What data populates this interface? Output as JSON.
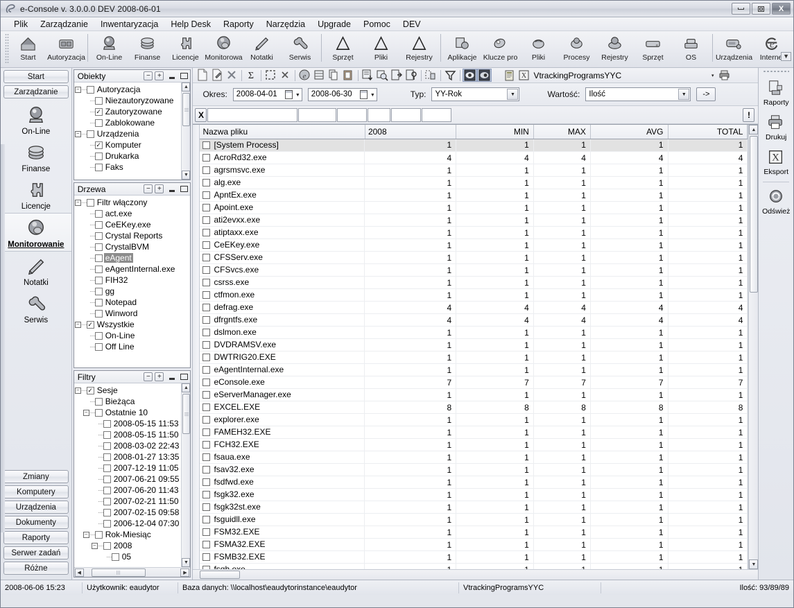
{
  "window": {
    "title": "e-Console v. 3.0.0.0 DEV 2008-06-01",
    "minimize_label": "Minimalizuj",
    "maximize_label": "Maksymalizuj",
    "close_label": "X"
  },
  "menubar": {
    "items": [
      "Plik",
      "Zarządzanie",
      "Inwentaryzacja",
      "Help Desk",
      "Raporty",
      "Narzędzia",
      "Upgrade",
      "Pomoc",
      "DEV"
    ]
  },
  "toolbar": {
    "groups": [
      [
        {
          "label": "Start",
          "icon": "home-icon"
        },
        {
          "label": "Autoryzacja",
          "icon": "authorize-icon"
        }
      ],
      [
        {
          "label": "On-Line",
          "icon": "online-icon"
        },
        {
          "label": "Finanse",
          "icon": "finance-icon"
        },
        {
          "label": "Licencje",
          "icon": "license-icon"
        },
        {
          "label": "Monitorowa",
          "icon": "monitoring-icon"
        },
        {
          "label": "Notatki",
          "icon": "notes-icon"
        },
        {
          "label": "Serwis",
          "icon": "service-icon"
        }
      ],
      [
        {
          "label": "Sprzęt",
          "icon": "delta-icon"
        },
        {
          "label": "Pliki",
          "icon": "delta-icon"
        },
        {
          "label": "Rejestry",
          "icon": "delta-icon"
        }
      ],
      [
        {
          "label": "Aplikacje",
          "icon": "applications-icon"
        },
        {
          "label": "Klucze pro",
          "icon": "keys-icon"
        },
        {
          "label": "Pliki",
          "icon": "files-icon"
        },
        {
          "label": "Procesy",
          "icon": "processes-icon"
        },
        {
          "label": "Rejestry",
          "icon": "registry-icon"
        },
        {
          "label": "Sprzęt",
          "icon": "hardware-icon"
        },
        {
          "label": "OS",
          "icon": "os-icon"
        }
      ],
      [
        {
          "label": "Urządzenia",
          "icon": "devices-icon"
        },
        {
          "label": "Internet",
          "icon": "internet-icon"
        }
      ]
    ],
    "overflow_label": "▼"
  },
  "leftnav": {
    "top_buttons": [
      "Start",
      "Zarządzanie"
    ],
    "icons": [
      {
        "label": "On-Line",
        "icon": "online-icon",
        "active": false
      },
      {
        "label": "Finanse",
        "icon": "finance-icon",
        "active": false
      },
      {
        "label": "Licencje",
        "icon": "license-icon",
        "active": false
      },
      {
        "label": "Monitorowanie",
        "icon": "monitoring-icon",
        "active": true
      },
      {
        "label": "Notatki",
        "icon": "notes-icon",
        "active": false
      },
      {
        "label": "Serwis",
        "icon": "service-icon",
        "active": false
      }
    ],
    "bottom_buttons": [
      "Zmiany",
      "Komputery",
      "Urządzenia",
      "Dokumenty",
      "Raporty",
      "Serwer zadań",
      "Różne"
    ]
  },
  "panels": [
    {
      "title": "Obiekty",
      "collapse_label": "−",
      "expand_label": "+",
      "nodes": [
        {
          "label": "Autoryzacja",
          "level": 0,
          "checked": false,
          "expander": "−"
        },
        {
          "label": "Niezautoryzowane",
          "level": 1,
          "checked": false
        },
        {
          "label": "Zautoryzowane",
          "level": 1,
          "checked": true
        },
        {
          "label": "Zablokowane",
          "level": 1,
          "checked": false
        },
        {
          "label": "Urządzenia",
          "level": 0,
          "checked": false,
          "expander": "−"
        },
        {
          "label": "Komputer",
          "level": 1,
          "checked": true
        },
        {
          "label": "Drukarka",
          "level": 1,
          "checked": false
        },
        {
          "label": "Faks",
          "level": 1,
          "checked": false
        }
      ]
    },
    {
      "title": "Drzewa",
      "collapse_label": "−",
      "expand_label": "+",
      "nodes": [
        {
          "label": "Filtr włączony",
          "level": 0,
          "checked": false,
          "expander": "−"
        },
        {
          "label": "act.exe",
          "level": 1,
          "checked": false
        },
        {
          "label": "CeEKey.exe",
          "level": 1,
          "checked": false
        },
        {
          "label": "Crystal Reports",
          "level": 1,
          "checked": false
        },
        {
          "label": "CrystalBVM",
          "level": 1,
          "checked": false
        },
        {
          "label": "eAgent",
          "level": 1,
          "checked": false,
          "selected": true
        },
        {
          "label": "eAgentInternal.exe",
          "level": 1,
          "checked": false
        },
        {
          "label": "FIH32",
          "level": 1,
          "checked": false
        },
        {
          "label": "gg",
          "level": 1,
          "checked": false
        },
        {
          "label": "Notepad",
          "level": 1,
          "checked": false
        },
        {
          "label": "Winword",
          "level": 1,
          "checked": false
        },
        {
          "label": "Wszystkie",
          "level": 0,
          "checked": true,
          "expander": "−"
        },
        {
          "label": "On-Line",
          "level": 1,
          "checked": false
        },
        {
          "label": "Off Line",
          "level": 1,
          "checked": false
        }
      ]
    },
    {
      "title": "Filtry",
      "collapse_label": "−",
      "expand_label": "+",
      "nodes": [
        {
          "label": "Sesje",
          "level": 0,
          "checked": true,
          "expander": "−"
        },
        {
          "label": "Bieżąca",
          "level": 1,
          "checked": false
        },
        {
          "label": "Ostatnie 10",
          "level": 1,
          "checked": false,
          "expander": "−"
        },
        {
          "label": "2008-05-15 11:53",
          "level": 2,
          "checked": false
        },
        {
          "label": "2008-05-15 11:50",
          "level": 2,
          "checked": false
        },
        {
          "label": "2008-03-02 22:43",
          "level": 2,
          "checked": false
        },
        {
          "label": "2008-01-27 13:35",
          "level": 2,
          "checked": false
        },
        {
          "label": "2007-12-19 11:05",
          "level": 2,
          "checked": false
        },
        {
          "label": "2007-06-21 09:55",
          "level": 2,
          "checked": false
        },
        {
          "label": "2007-06-20 11:43",
          "level": 2,
          "checked": false
        },
        {
          "label": "2007-02-21 11:50",
          "level": 2,
          "checked": false
        },
        {
          "label": "2007-02-15 09:58",
          "level": 2,
          "checked": false
        },
        {
          "label": "2006-12-04 07:30",
          "level": 2,
          "checked": false
        },
        {
          "label": "Rok-Miesiąc",
          "level": 1,
          "checked": false,
          "expander": "−"
        },
        {
          "label": "2008",
          "level": 2,
          "checked": false,
          "expander": "−"
        },
        {
          "label": "05",
          "level": 3,
          "checked": false
        }
      ]
    }
  ],
  "mini_toolbar": {
    "icons": [
      "new-document-icon",
      "edit-document-icon",
      "delete-x-icon",
      "sum-sigma-icon",
      "select-region-icon",
      "clear-x-icon",
      "browser-icon",
      "list-icon",
      "copy-icon",
      "paste-icon",
      "export-list-icon",
      "search-list-icon",
      "open-out-icon",
      "config-out-icon",
      "columns-icon",
      "filter-funnel-icon",
      "preview-icon",
      "preview2-icon"
    ],
    "report_icon_1": "report-icon",
    "report_icon_2": "excel-icon",
    "report_name": "VtrackingProgramsYYC",
    "dropdown_caret": "▾",
    "print_icon": "print-icon"
  },
  "filterbar": {
    "period_label": "Okres:",
    "date_from": "2008-04-01",
    "date_to": "2008-06-30",
    "type_label": "Typ:",
    "type_value": "YY-Rok",
    "value_label": "Wartość:",
    "value_value": "Ilość",
    "go_label": "->"
  },
  "searchrow": {
    "clear_label": "X",
    "bang_label": "!",
    "fields": [
      "",
      "",
      "",
      "",
      "",
      ""
    ]
  },
  "grid": {
    "columns": [
      "Nazwa pliku",
      "2008",
      "MIN",
      "MAX",
      "AVG",
      "TOTAL"
    ],
    "rows": [
      {
        "name": "[System Process]",
        "v": [
          1,
          1,
          1,
          1,
          1
        ],
        "selected": true
      },
      {
        "name": "AcroRd32.exe",
        "v": [
          4,
          4,
          4,
          4,
          4
        ]
      },
      {
        "name": "agrsmsvc.exe",
        "v": [
          1,
          1,
          1,
          1,
          1
        ]
      },
      {
        "name": "alg.exe",
        "v": [
          1,
          1,
          1,
          1,
          1
        ]
      },
      {
        "name": "ApntEx.exe",
        "v": [
          1,
          1,
          1,
          1,
          1
        ]
      },
      {
        "name": "Apoint.exe",
        "v": [
          1,
          1,
          1,
          1,
          1
        ]
      },
      {
        "name": "ati2evxx.exe",
        "v": [
          1,
          1,
          1,
          1,
          1
        ]
      },
      {
        "name": "atiptaxx.exe",
        "v": [
          1,
          1,
          1,
          1,
          1
        ]
      },
      {
        "name": "CeEKey.exe",
        "v": [
          1,
          1,
          1,
          1,
          1
        ]
      },
      {
        "name": "CFSServ.exe",
        "v": [
          1,
          1,
          1,
          1,
          1
        ]
      },
      {
        "name": "CFSvcs.exe",
        "v": [
          1,
          1,
          1,
          1,
          1
        ]
      },
      {
        "name": "csrss.exe",
        "v": [
          1,
          1,
          1,
          1,
          1
        ]
      },
      {
        "name": "ctfmon.exe",
        "v": [
          1,
          1,
          1,
          1,
          1
        ]
      },
      {
        "name": "defrag.exe",
        "v": [
          4,
          4,
          4,
          4,
          4
        ]
      },
      {
        "name": "dfrgntfs.exe",
        "v": [
          4,
          4,
          4,
          4,
          4
        ]
      },
      {
        "name": "dslmon.exe",
        "v": [
          1,
          1,
          1,
          1,
          1
        ]
      },
      {
        "name": "DVDRAMSV.exe",
        "v": [
          1,
          1,
          1,
          1,
          1
        ]
      },
      {
        "name": "DWTRIG20.EXE",
        "v": [
          1,
          1,
          1,
          1,
          1
        ]
      },
      {
        "name": "eAgentInternal.exe",
        "v": [
          1,
          1,
          1,
          1,
          1
        ]
      },
      {
        "name": "eConsole.exe",
        "v": [
          7,
          7,
          7,
          7,
          7
        ]
      },
      {
        "name": "eServerManager.exe",
        "v": [
          1,
          1,
          1,
          1,
          1
        ]
      },
      {
        "name": "EXCEL.EXE",
        "v": [
          8,
          8,
          8,
          8,
          8
        ]
      },
      {
        "name": "explorer.exe",
        "v": [
          1,
          1,
          1,
          1,
          1
        ]
      },
      {
        "name": "FAMEH32.EXE",
        "v": [
          1,
          1,
          1,
          1,
          1
        ]
      },
      {
        "name": "FCH32.EXE",
        "v": [
          1,
          1,
          1,
          1,
          1
        ]
      },
      {
        "name": "fsaua.exe",
        "v": [
          1,
          1,
          1,
          1,
          1
        ]
      },
      {
        "name": "fsav32.exe",
        "v": [
          1,
          1,
          1,
          1,
          1
        ]
      },
      {
        "name": "fsdfwd.exe",
        "v": [
          1,
          1,
          1,
          1,
          1
        ]
      },
      {
        "name": "fsgk32.exe",
        "v": [
          1,
          1,
          1,
          1,
          1
        ]
      },
      {
        "name": "fsgk32st.exe",
        "v": [
          1,
          1,
          1,
          1,
          1
        ]
      },
      {
        "name": "fsguidll.exe",
        "v": [
          1,
          1,
          1,
          1,
          1
        ]
      },
      {
        "name": "FSM32.EXE",
        "v": [
          1,
          1,
          1,
          1,
          1
        ]
      },
      {
        "name": "FSMA32.EXE",
        "v": [
          1,
          1,
          1,
          1,
          1
        ]
      },
      {
        "name": "FSMB32.EXE",
        "v": [
          1,
          1,
          1,
          1,
          1
        ]
      },
      {
        "name": "fsqh.exe",
        "v": [
          1,
          1,
          1,
          1,
          1
        ]
      }
    ]
  },
  "rightnav": {
    "items": [
      {
        "label": "Raporty",
        "icon": "reports-icon"
      },
      {
        "label": "Drukuj",
        "icon": "printer-icon"
      },
      {
        "label": "Eksport",
        "icon": "excel-export-icon"
      },
      {
        "label": "Odśwież",
        "icon": "refresh-icon"
      }
    ]
  },
  "statusbar": {
    "datetime": "2008-06-06  15:23",
    "user": "Użytkownik: eaudytor",
    "database": "Baza danych: \\\\localhost\\eaudytorinstance\\eaudytor",
    "report": "VtrackingProgramsYYC",
    "count": "Ilość: 93/89/89"
  }
}
